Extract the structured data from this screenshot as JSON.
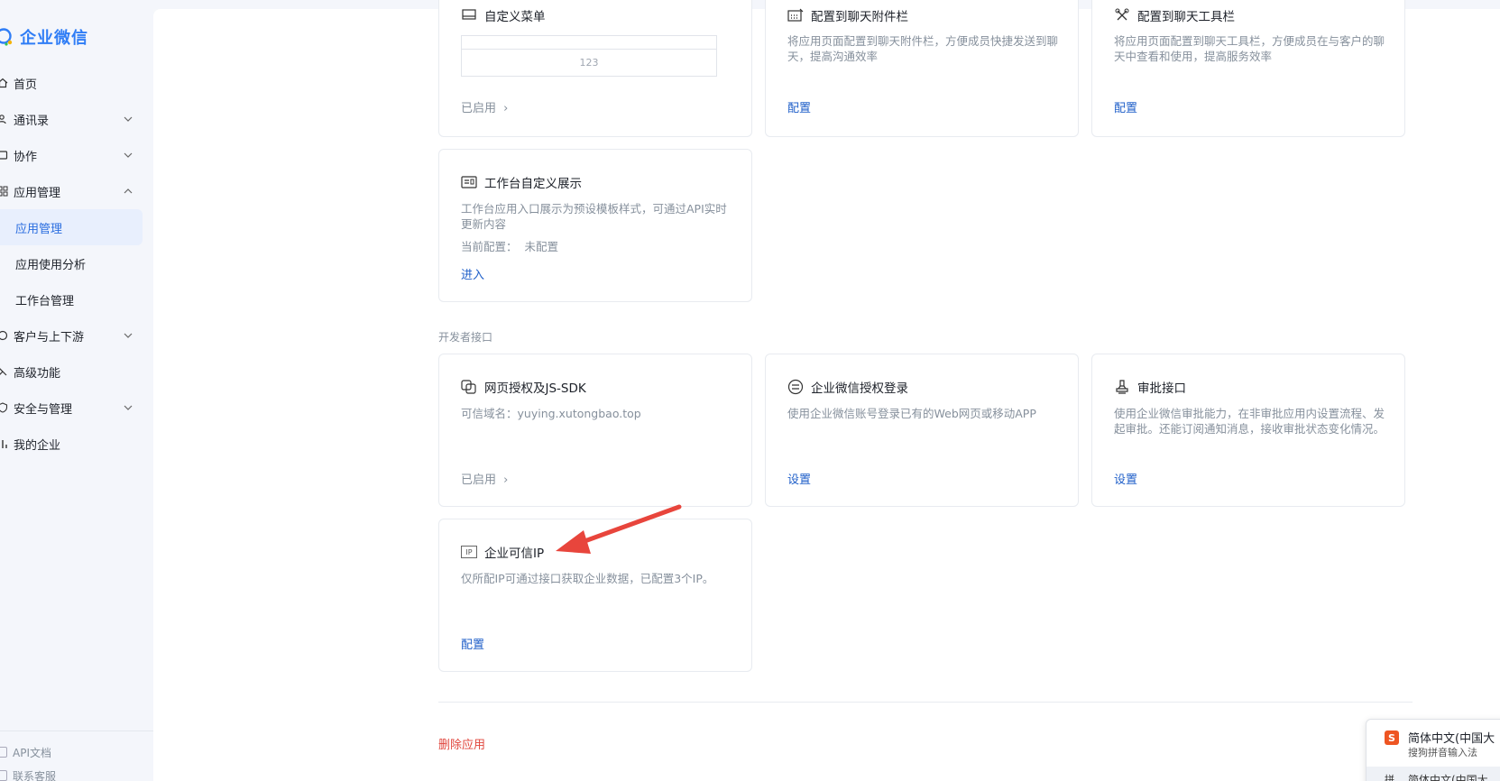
{
  "app": {
    "logo_text": "企业微信"
  },
  "sidebar": {
    "items": [
      {
        "label": "首页"
      },
      {
        "label": "通讯录"
      },
      {
        "label": "协作"
      },
      {
        "label": "应用管理"
      },
      {
        "label": "应用管理"
      },
      {
        "label": "应用使用分析"
      },
      {
        "label": "工作台管理"
      },
      {
        "label": "客户与上下游"
      },
      {
        "label": "高级功能"
      },
      {
        "label": "安全与管理"
      },
      {
        "label": "我的企业"
      }
    ],
    "bottom": [
      {
        "label": "API文档"
      },
      {
        "label": "联系客服"
      }
    ]
  },
  "cards": {
    "custom_menu": {
      "title": "自定义菜单",
      "preview_text": "123",
      "status": "已启用",
      "status_chevron": "›"
    },
    "chat_attachment": {
      "title": "配置到聊天附件栏",
      "desc": "将应用页面配置到聊天附件栏，方便成员快捷发送到聊天，提高沟通效率",
      "link": "配置"
    },
    "chat_toolbar": {
      "title": "配置到聊天工具栏",
      "desc": "将应用页面配置到聊天工具栏，方便成员在与客户的聊天中查看和使用，提高服务效率",
      "link": "配置"
    },
    "workbench_display": {
      "title": "工作台自定义展示",
      "desc": "工作台应用入口展示为预设模板样式，可通过API实时更新内容",
      "current_label": "当前配置：",
      "current_value": "未配置",
      "link": "进入"
    },
    "web_auth": {
      "title": "网页授权及JS-SDK",
      "desc": "可信域名：yuying.xutongbao.top",
      "status": "已启用",
      "status_chevron": "›"
    },
    "wecom_login": {
      "title": "企业微信授权登录",
      "desc": "使用企业微信账号登录已有的Web网页或移动APP",
      "link": "设置"
    },
    "approval": {
      "title": "审批接口",
      "desc": "使用企业微信审批能力，在非审批应用内设置流程、发起审批。还能订阅通知消息，接收审批状态变化情况。",
      "link": "设置"
    },
    "trusted_ip": {
      "title": "企业可信IP",
      "icon_text": "IP",
      "desc": "仅所配IP可通过接口获取企业数据，已配置3个IP。",
      "link": "配置"
    }
  },
  "sections": {
    "developer_api": "开发者接口"
  },
  "actions": {
    "delete_app": "删除应用"
  },
  "ime": {
    "title": "简体中文(中国大",
    "subtitle": "搜狗拼音输入法",
    "second_prefix": "拼",
    "second_title": "简体中文(中国大"
  },
  "colors": {
    "accent": "#2f7df6",
    "link": "#1f5fc9",
    "danger": "#e0463d",
    "annotation_arrow": "#e8453c"
  }
}
